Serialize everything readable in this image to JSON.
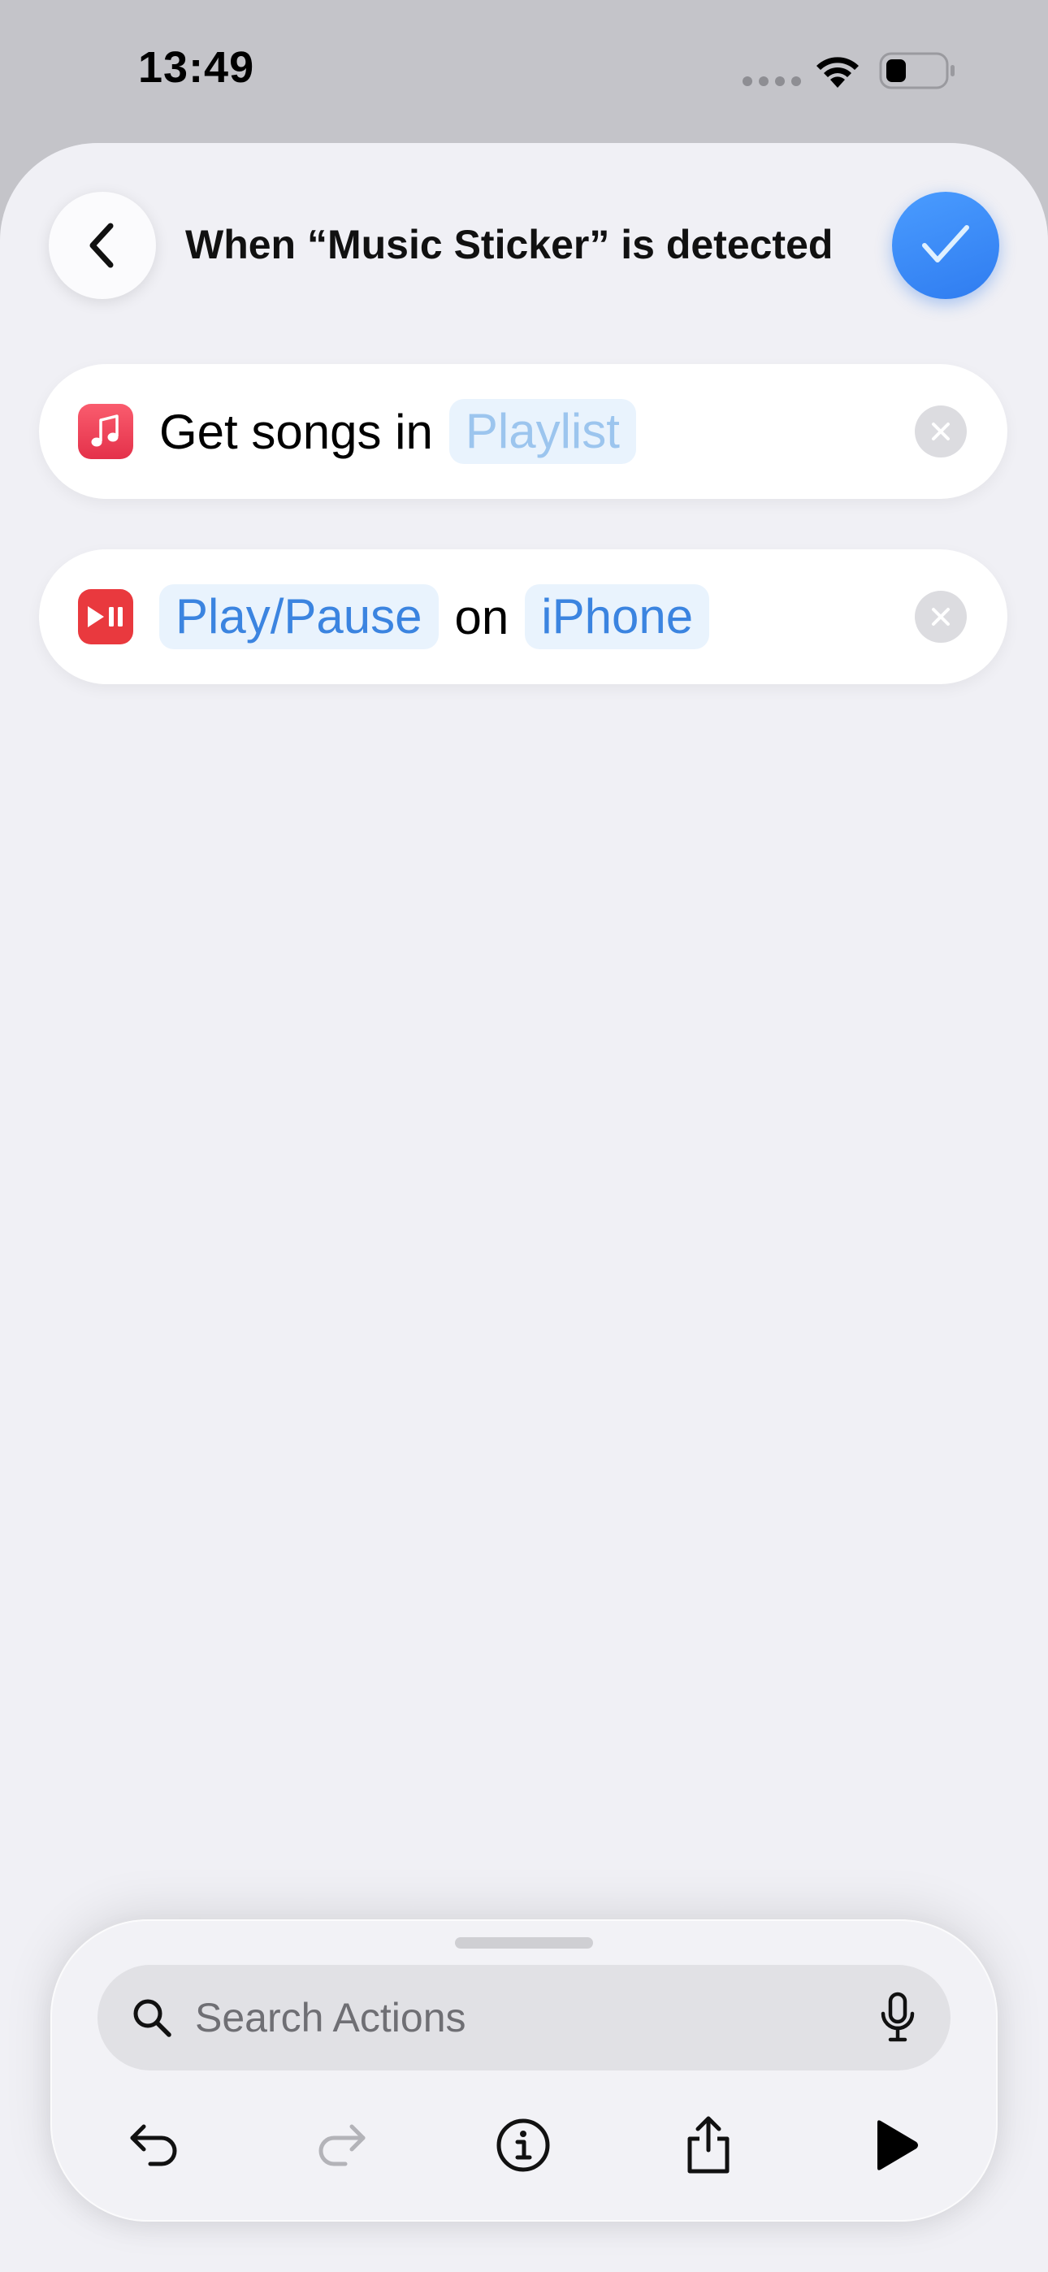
{
  "status_bar": {
    "time": "13:49"
  },
  "header": {
    "title": "When “Music Sticker” is detected",
    "back_icon": "chevron-left-icon",
    "done_icon": "checkmark-icon"
  },
  "actions": [
    {
      "app_icon": "music-note-icon",
      "text": "Get songs in",
      "parameter": "Playlist",
      "parameter_is_placeholder": true
    },
    {
      "app_icon": "play-pause-icon",
      "parameter": "Play/Pause",
      "connector": "on",
      "device": "iPhone"
    }
  ],
  "search": {
    "placeholder": "Search Actions",
    "value": ""
  },
  "toolbar": {
    "icons": [
      "undo-icon",
      "redo-icon",
      "info-icon",
      "share-icon",
      "play-icon"
    ]
  },
  "colors": {
    "accent": "#3b84e0",
    "done_button": "#2f7cf0",
    "music_red": "#e4314a",
    "sheet_background": "#f0f0f5"
  }
}
